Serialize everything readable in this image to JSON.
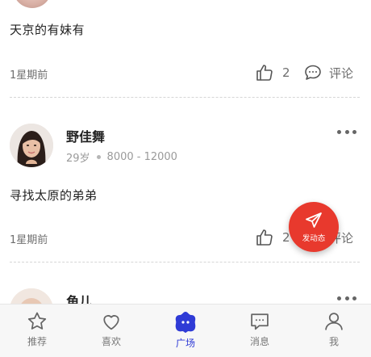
{
  "posts": [
    {
      "text": "天京的有妹有",
      "time": "1星期前",
      "likes": "2",
      "comment_label": "评论"
    },
    {
      "user_name": "野佳舞",
      "age": "29岁",
      "income": "8000 - 12000",
      "text": "寻找太原的弟弟",
      "time": "1星期前",
      "likes": "2",
      "comment_label": "评论"
    },
    {
      "user_name": "角儿"
    }
  ],
  "fab": {
    "label": "发动态"
  },
  "tabbar": {
    "items": [
      {
        "label": "推荐",
        "icon": "star-icon",
        "active": false
      },
      {
        "label": "喜欢",
        "icon": "heart-icon",
        "active": false
      },
      {
        "label": "广场",
        "icon": "plaza-icon",
        "active": true
      },
      {
        "label": "消息",
        "icon": "message-icon",
        "active": false
      },
      {
        "label": "我",
        "icon": "person-icon",
        "active": false
      }
    ]
  },
  "colors": {
    "accent": "#2f3bd6",
    "fab": "#e8392d",
    "muted": "#6e6e6e"
  }
}
